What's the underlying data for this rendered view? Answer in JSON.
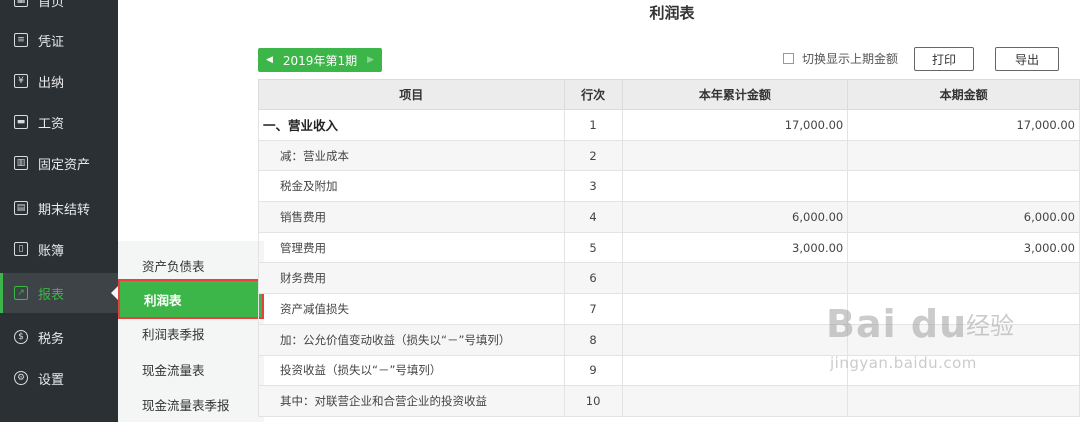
{
  "sidebar": {
    "items": [
      {
        "label": "首页",
        "icon": "grid-icon"
      },
      {
        "label": "凭证",
        "icon": "document-icon"
      },
      {
        "label": "出纳",
        "icon": "wallet-icon"
      },
      {
        "label": "工资",
        "icon": "card-icon"
      },
      {
        "label": "固定资产",
        "icon": "building-icon"
      },
      {
        "label": "期末结转",
        "icon": "calendar-icon"
      },
      {
        "label": "账簿",
        "icon": "book-icon"
      },
      {
        "label": "报表",
        "icon": "chart-icon"
      },
      {
        "label": "税务",
        "icon": "tax-icon"
      },
      {
        "label": "设置",
        "icon": "gear-icon"
      }
    ]
  },
  "submenu": {
    "items": [
      {
        "label": "资产负债表"
      },
      {
        "label": "利润表"
      },
      {
        "label": "利润表季报"
      },
      {
        "label": "现金流量表"
      },
      {
        "label": "现金流量表季报"
      }
    ]
  },
  "page": {
    "title": "利润表",
    "period": "2019年第1期",
    "toggle_label": "切换显示上期金额",
    "print_label": "打印",
    "export_label": "导出"
  },
  "table": {
    "headers": [
      "项目",
      "行次",
      "本年累计金额",
      "本期金额"
    ],
    "rows": [
      {
        "item": "一、营业收入",
        "row": "1",
        "ytd": "17,000.00",
        "cur": "17,000.00"
      },
      {
        "item": "减：营业成本",
        "row": "2",
        "ytd": "",
        "cur": ""
      },
      {
        "item": "税金及附加",
        "row": "3",
        "ytd": "",
        "cur": ""
      },
      {
        "item": "销售费用",
        "row": "4",
        "ytd": "6,000.00",
        "cur": "6,000.00"
      },
      {
        "item": "管理费用",
        "row": "5",
        "ytd": "3,000.00",
        "cur": "3,000.00"
      },
      {
        "item": "财务费用",
        "row": "6",
        "ytd": "",
        "cur": ""
      },
      {
        "item": "资产减值损失",
        "row": "7",
        "ytd": "",
        "cur": ""
      },
      {
        "item": "加：公允价值变动收益（损失以“－”号填列）",
        "row": "8",
        "ytd": "",
        "cur": ""
      },
      {
        "item": "投资收益（损失以“－”号填列）",
        "row": "9",
        "ytd": "",
        "cur": ""
      },
      {
        "item": "其中：对联营企业和合营企业的投资收益",
        "row": "10",
        "ytd": "",
        "cur": ""
      }
    ]
  },
  "watermark": {
    "logo": "Bai du",
    "cn": "经验",
    "url": "jingyan.baidu.com"
  },
  "colors": {
    "accent": "#3cb648",
    "sidebar_bg": "#2b3034",
    "highlight_border": "#e84040"
  }
}
